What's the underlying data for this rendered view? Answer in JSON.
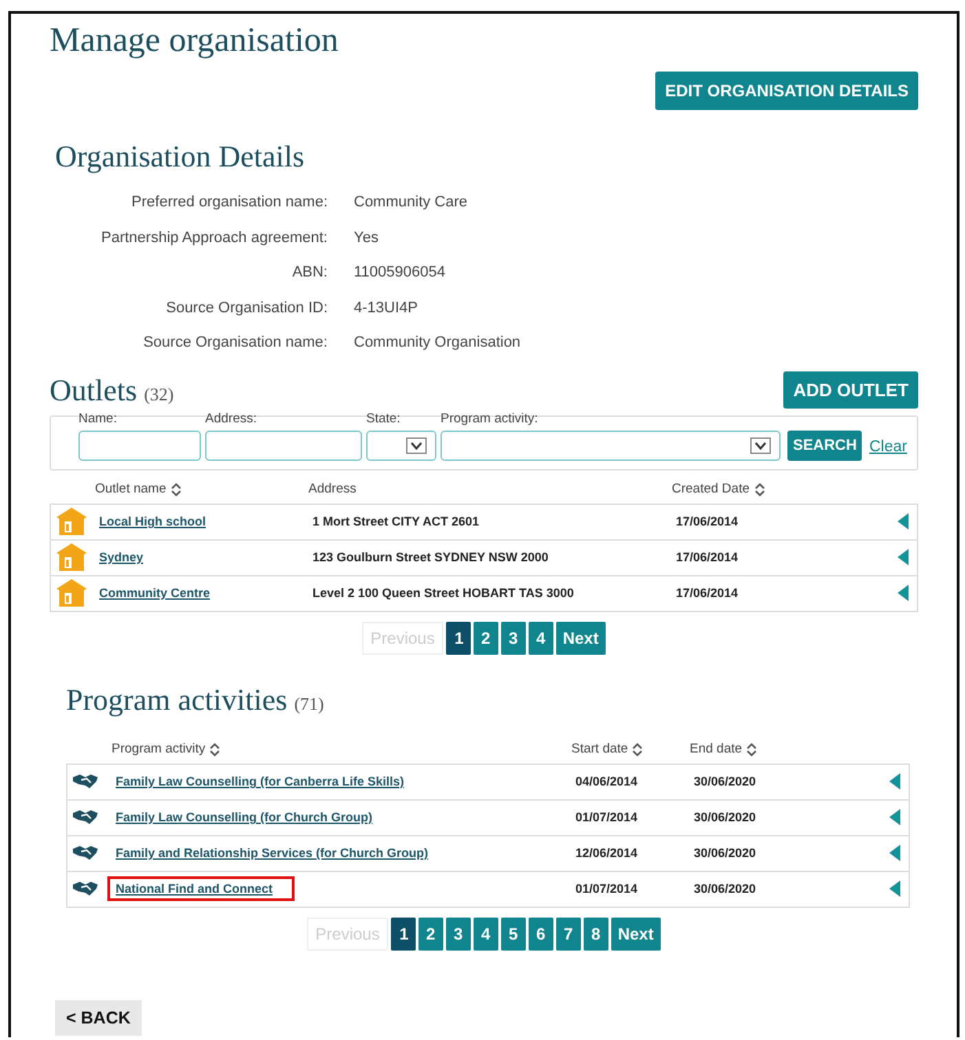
{
  "page": {
    "title": "Manage organisation",
    "edit_button": "EDIT ORGANISATION DETAILS"
  },
  "details": {
    "heading": "Organisation Details",
    "fields": [
      {
        "label": "Preferred organisation name:",
        "value": "Community Care"
      },
      {
        "label": "Partnership Approach agreement:",
        "value": "Yes"
      },
      {
        "label": "ABN:",
        "value": "11005906054"
      },
      {
        "label": "Source Organisation ID:",
        "value": "4-13UI4P"
      },
      {
        "label": "Source Organisation name:",
        "value": "Community Organisation"
      }
    ]
  },
  "outlets": {
    "heading": "Outlets",
    "count": "(32)",
    "add_button": "ADD OUTLET",
    "filters": {
      "name_label": "Name:",
      "address_label": "Address:",
      "state_label": "State:",
      "program_label": "Program activity:",
      "search_button": "SEARCH",
      "clear_link": "Clear"
    },
    "columns": [
      {
        "label": "Outlet name",
        "sortable": true
      },
      {
        "label": "Address",
        "sortable": false
      },
      {
        "label": "Created Date",
        "sortable": true
      }
    ],
    "rows": [
      {
        "name": "Local High school",
        "address": "1 Mort Street CITY ACT 2601",
        "created": "17/06/2014"
      },
      {
        "name": "Sydney",
        "address": "123 Goulburn Street SYDNEY NSW 2000",
        "created": "17/06/2014"
      },
      {
        "name": "Community Centre",
        "address": "Level 2 100 Queen Street HOBART TAS 3000",
        "created": "17/06/2014"
      }
    ],
    "pagination": {
      "previous": {
        "label": "Previous",
        "disabled": true
      },
      "pages": [
        {
          "label": "1",
          "selected": true
        },
        {
          "label": "2",
          "selected": false
        },
        {
          "label": "3",
          "selected": false
        },
        {
          "label": "4",
          "selected": false
        }
      ],
      "next": {
        "label": "Next",
        "disabled": false
      }
    }
  },
  "programs": {
    "heading": "Program activities",
    "count": "(71)",
    "columns": [
      {
        "label": "Program activity",
        "sortable": true
      },
      {
        "label": "Start date",
        "sortable": true
      },
      {
        "label": "End date",
        "sortable": true
      }
    ],
    "rows": [
      {
        "name": "Family Law Counselling (for Canberra Life Skills)",
        "start": "04/06/2014",
        "end": "30/06/2020",
        "highlighted": false
      },
      {
        "name": "Family Law Counselling (for Church Group)",
        "start": "01/07/2014",
        "end": "30/06/2020",
        "highlighted": false
      },
      {
        "name": "Family and Relationship Services (for Church Group)",
        "start": "12/06/2014",
        "end": "30/06/2020",
        "highlighted": false
      },
      {
        "name": "National Find and Connect",
        "start": "01/07/2014",
        "end": "30/06/2020",
        "highlighted": true
      }
    ],
    "pagination": {
      "previous": {
        "label": "Previous",
        "disabled": true
      },
      "pages": [
        {
          "label": "1",
          "selected": true
        },
        {
          "label": "2",
          "selected": false
        },
        {
          "label": "3",
          "selected": false
        },
        {
          "label": "4",
          "selected": false
        },
        {
          "label": "5",
          "selected": false
        },
        {
          "label": "6",
          "selected": false
        },
        {
          "label": "7",
          "selected": false
        },
        {
          "label": "8",
          "selected": false
        }
      ],
      "next": {
        "label": "Next",
        "disabled": false
      }
    }
  },
  "back_button": "< BACK"
}
